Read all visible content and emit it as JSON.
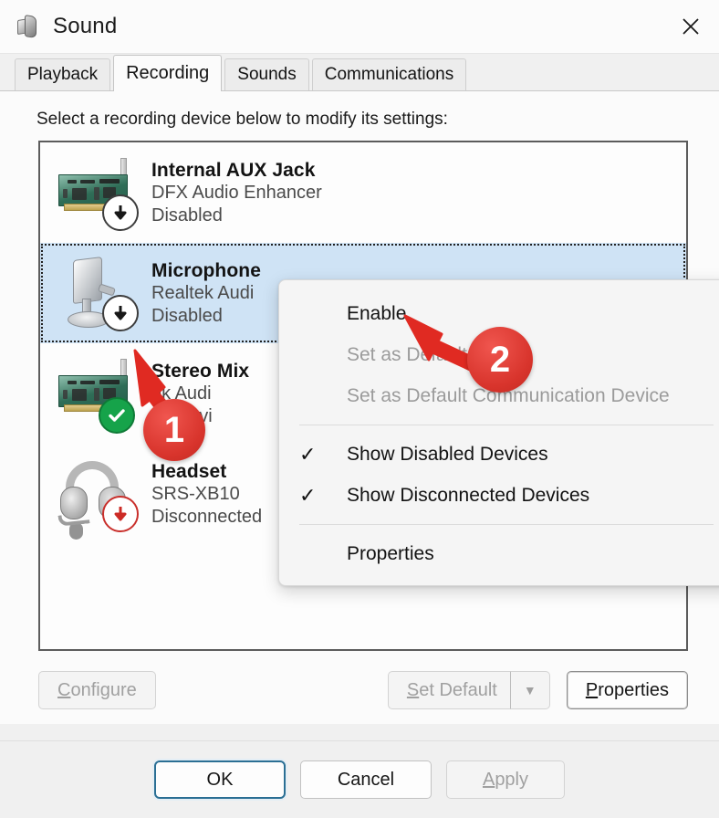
{
  "window": {
    "title": "Sound",
    "icon": "sound-speaker-icon",
    "close_label": "✕"
  },
  "tabs": [
    {
      "label": "Playback",
      "active": false
    },
    {
      "label": "Recording",
      "active": true
    },
    {
      "label": "Sounds",
      "active": false
    },
    {
      "label": "Communications",
      "active": false
    }
  ],
  "page": {
    "hint": "Select a recording device below to modify its settings:"
  },
  "devices": [
    {
      "name": "Internal AUX Jack",
      "description": "DFX Audio Enhancer",
      "status": "Disabled",
      "icon": "sound-card-icon",
      "badge": "disabled",
      "selected": false
    },
    {
      "name": "Microphone",
      "description": "Realtek Audi",
      "status": "Disabled",
      "icon": "desktop-microphone-icon",
      "badge": "disabled",
      "selected": true
    },
    {
      "name": "Stereo Mix",
      "description": "ek Audi",
      "status": "ult Devi",
      "icon": "sound-card-icon",
      "badge": "default",
      "selected": false
    },
    {
      "name": "Headset",
      "description": "SRS-XB10",
      "status": "Disconnected",
      "icon": "headset-icon",
      "badge": "disconnected",
      "selected": false
    }
  ],
  "context_menu": {
    "items": [
      {
        "label": "Enable",
        "enabled": true,
        "checked": false
      },
      {
        "label": "Set as Default Device",
        "enabled": false,
        "checked": false
      },
      {
        "label": "Set as Default Communication Device",
        "enabled": false,
        "checked": false
      },
      {
        "separator": true
      },
      {
        "label": "Show Disabled Devices",
        "enabled": true,
        "checked": true
      },
      {
        "label": "Show Disconnected Devices",
        "enabled": true,
        "checked": true
      },
      {
        "separator": true
      },
      {
        "label": "Properties",
        "enabled": true,
        "checked": false
      }
    ],
    "check_glyph": "✓"
  },
  "callouts": [
    {
      "number": "1",
      "target": "microphone-disabled-badge"
    },
    {
      "number": "2",
      "target": "enable-menu-item"
    }
  ],
  "toolbar": {
    "configure": "Configure",
    "configure_mnemonic": "C",
    "set_default": "Set Default",
    "set_default_mnemonic": "S",
    "dropdown_glyph": "▼",
    "properties": "Properties",
    "properties_mnemonic": "P"
  },
  "footer": {
    "ok": "OK",
    "cancel": "Cancel",
    "apply": "Apply",
    "apply_mnemonic": "A"
  },
  "colors": {
    "selection": "#cfe3f5",
    "callout_red": "#d8342c",
    "default_badge_green": "#16a34a",
    "disconnected_red": "#c9302c",
    "ok_focus_border": "#2b6f94"
  }
}
